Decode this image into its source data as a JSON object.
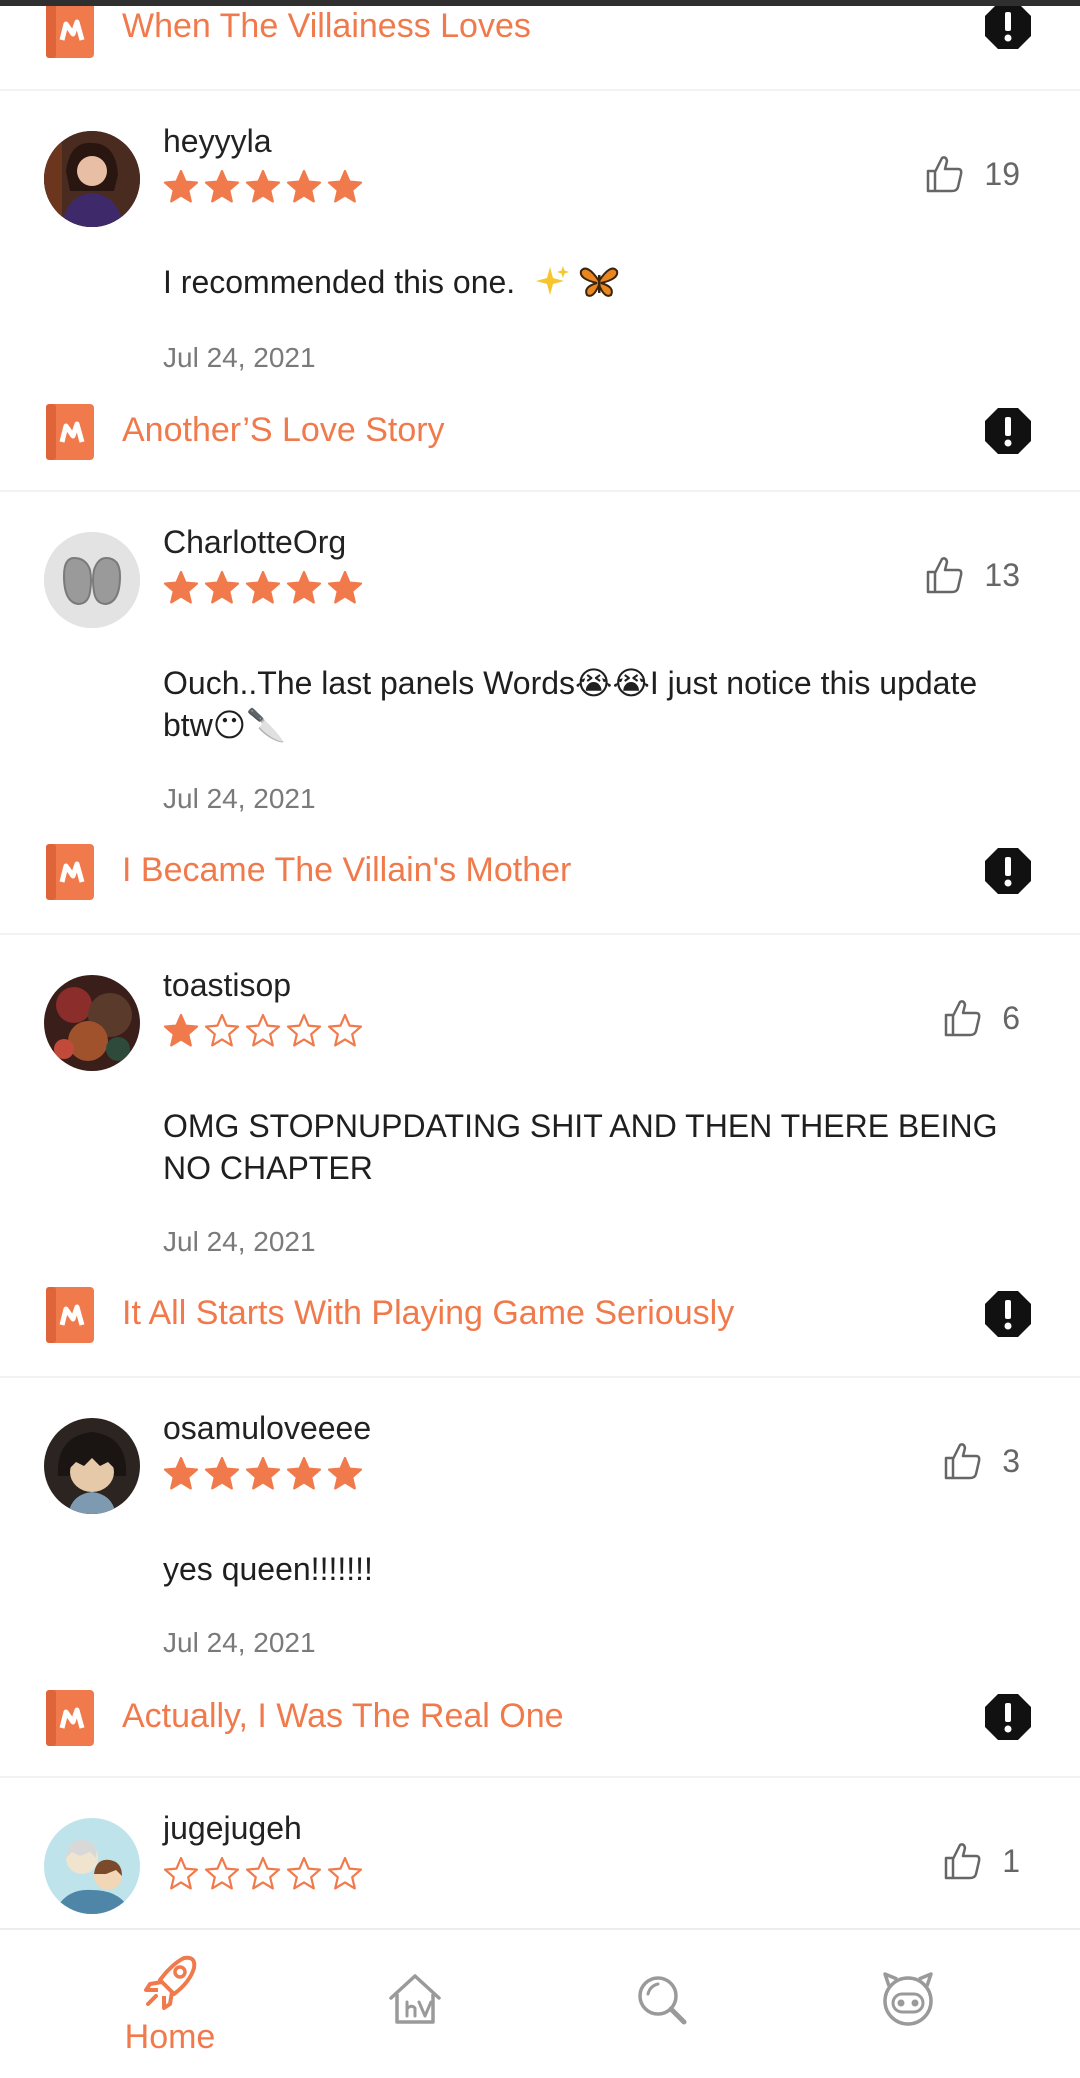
{
  "colors": {
    "accent": "#f07a4b",
    "text": "#222222",
    "muted": "#7a7a7a",
    "divider": "#f2f2f2"
  },
  "feed": {
    "items": [
      {
        "book_title": "When The Villainess Loves",
        "username": "heyyyla",
        "rating": 5,
        "likes": "19",
        "text": "I recommended this one.",
        "emojis": [
          "sparkles-emoji",
          "butterfly-emoji"
        ],
        "date": "Jul 24, 2021"
      },
      {
        "book_title": "Another’S Love Story",
        "username": "CharlotteOrg",
        "rating": 5,
        "likes": "13",
        "text": "Ouch..The last panels Words😭😭I just notice this update btw😶🔪",
        "date": "Jul 24, 2021"
      },
      {
        "book_title": "I Became The Villain's Mother",
        "username": "toastisop",
        "rating": 1,
        "likes": "6",
        "text": "OMG STOPNUPDATING SHIT AND THEN THERE BEING NO CHAPTER",
        "date": "Jul 24, 2021"
      },
      {
        "book_title": "It All Starts With Playing Game Seriously",
        "username": "osamuloveeee",
        "rating": 5,
        "likes": "3",
        "text": "yes queen!!!!!!!",
        "date": "Jul 24, 2021"
      },
      {
        "book_title": "Actually, I Was The Real One",
        "username": "jugejugeh",
        "rating": 0,
        "likes": "1"
      }
    ]
  },
  "bottom_nav": {
    "items": [
      {
        "icon": "rocket-icon",
        "label": "Home",
        "active": true
      },
      {
        "icon": "home-tv-icon",
        "label": "",
        "active": false
      },
      {
        "icon": "search-icon",
        "label": "",
        "active": false
      },
      {
        "icon": "profile-face-icon",
        "label": "",
        "active": false
      }
    ]
  }
}
